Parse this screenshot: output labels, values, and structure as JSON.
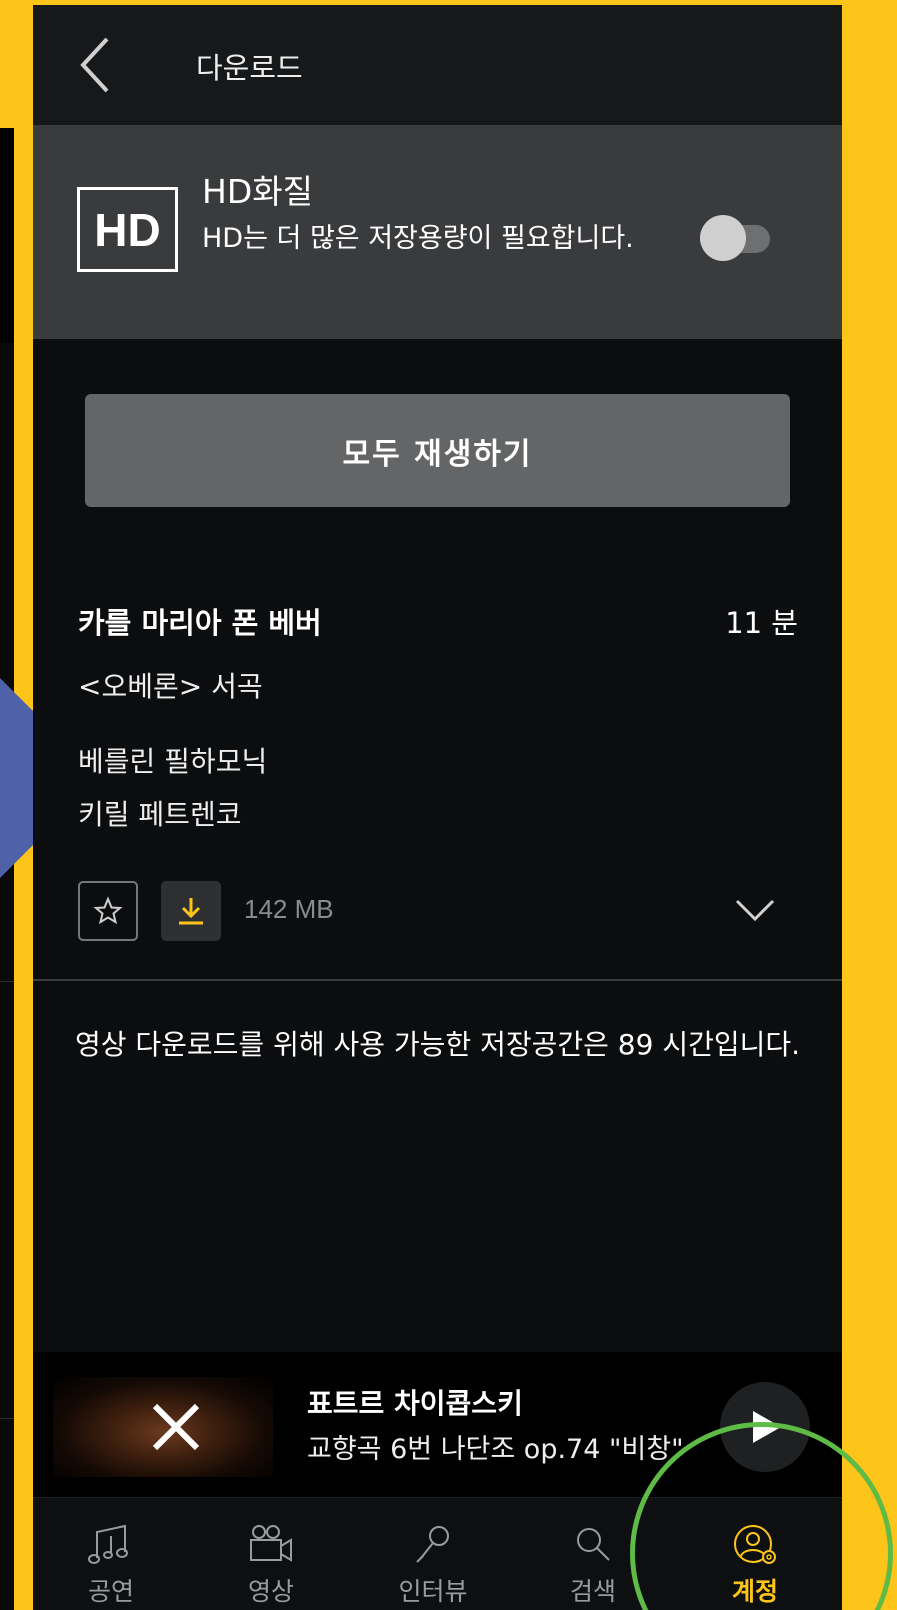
{
  "header": {
    "title": "다운로드"
  },
  "hd": {
    "badge": "HD",
    "title": "HD화질",
    "description": "HD는 더 많은 저장용량이 필요합니다.",
    "enabled": false
  },
  "play_all_label": "모두 재생하기",
  "item": {
    "composer": "카를 마리아 폰 베버",
    "duration": "11 분",
    "work": "<오베론> 서곡",
    "performers": [
      "베를린 필하모닉",
      "키릴 페트렌코"
    ],
    "size": "142 MB"
  },
  "storage_message": "영상 다운로드를 위해 사용 가능한 저장공간은 89 시간입니다.",
  "mini_player": {
    "title": "표트르 차이콥스키",
    "subtitle": "교향곡 6번 나단조 op.74 \"비창\""
  },
  "nav": {
    "items": [
      {
        "label": "공연",
        "icon": "music-notes-icon"
      },
      {
        "label": "영상",
        "icon": "video-camera-icon"
      },
      {
        "label": "인터뷰",
        "icon": "microphone-icon"
      },
      {
        "label": "검색",
        "icon": "search-icon"
      },
      {
        "label": "계정",
        "icon": "account-settings-icon",
        "active": true
      }
    ]
  },
  "colors": {
    "accent": "#FDC41A",
    "background": "#0c0d0f",
    "annotation": "#5DBB46",
    "arrow": "#4F62A9"
  }
}
